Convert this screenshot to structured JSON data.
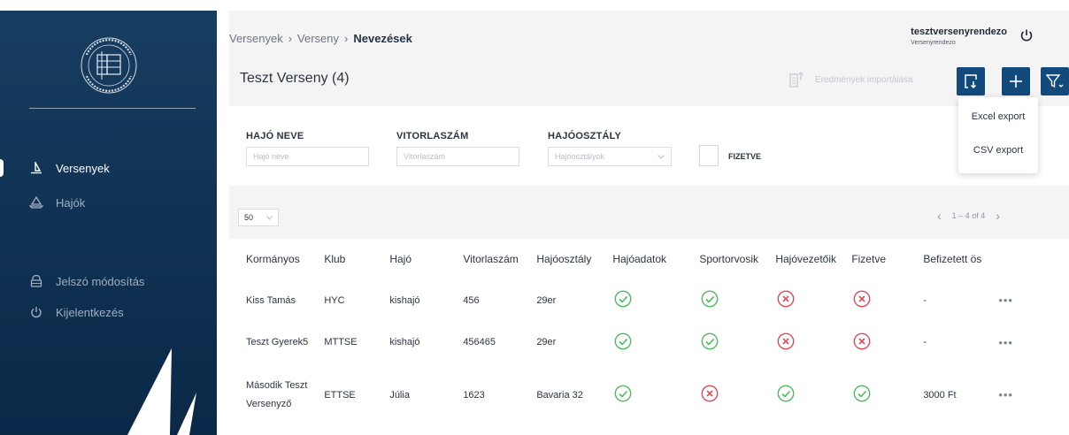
{
  "brand": {
    "accent": "#124a7c",
    "sidebar_bg": "#173d60",
    "ok_color": "#4cbb5c",
    "fail_color": "#e04a5a"
  },
  "sidebar": {
    "items": [
      {
        "label": "Versenyek",
        "icon": "sailboat-icon",
        "active": true
      },
      {
        "label": "Hajók",
        "icon": "boat-icon",
        "active": false
      },
      {
        "label": "Jelszó módosítás",
        "icon": "lock-icon",
        "active": false
      },
      {
        "label": "Kijelentkezés",
        "icon": "power-icon",
        "active": false
      }
    ]
  },
  "breadcrumb": {
    "items": [
      "Versenyek",
      "Verseny",
      "Nevezések"
    ]
  },
  "page": {
    "title": "Teszt Verseny (4)"
  },
  "user": {
    "name": "tesztversenyrendezo",
    "role": "Versenyrendezo"
  },
  "toolbar": {
    "import_label": "Eredmények importálása",
    "export_icon": "export-icon",
    "add_icon": "plus-icon",
    "filter_icon": "filter-icon"
  },
  "export_menu": {
    "items": [
      "Excel export",
      "CSV export"
    ]
  },
  "filters": {
    "ship_name": {
      "label": "HAJÓ NEVE",
      "placeholder": "Hajó neve"
    },
    "sail_number": {
      "label": "VITORLASZÁM",
      "placeholder": "Vitorlaszám"
    },
    "ship_class": {
      "label": "HAJÓOSZTÁLY",
      "placeholder": "Hajóosztályok"
    },
    "paid": {
      "label": "FIZETVE"
    }
  },
  "pagination": {
    "page_size": "50",
    "range": "1 – 4 of 4"
  },
  "table": {
    "columns": [
      "Kormányos",
      "Klub",
      "Hajó",
      "Vitorlaszám",
      "Hajóosztály",
      "Hajóadatok",
      "Sportorvosik",
      "Hajóvezetőik",
      "Fizetve",
      "Befizetett ös"
    ],
    "rows": [
      {
        "helmsman": "Kiss Tamás",
        "club": "HYC",
        "ship": "kishajó",
        "sail_number": "456",
        "ship_class": "29er",
        "ship_data": "ok",
        "medical": "ok",
        "skipper": "fail",
        "paid": "fail",
        "amount": "-"
      },
      {
        "helmsman": "Teszt Gyerek5",
        "club": "MTTSE",
        "ship": "kishajó",
        "sail_number": "456465",
        "ship_class": "29er",
        "ship_data": "ok",
        "medical": "ok",
        "skipper": "fail",
        "paid": "fail",
        "amount": "-"
      },
      {
        "helmsman": "Második Teszt Versenyző",
        "club": "ETTSE",
        "ship": "Júlia",
        "sail_number": "1623",
        "ship_class": "Bavaria 32",
        "ship_data": "ok",
        "medical": "fail",
        "skipper": "ok",
        "paid": "ok",
        "amount": "3000 Ft"
      }
    ],
    "row_menu_label": "•••"
  }
}
